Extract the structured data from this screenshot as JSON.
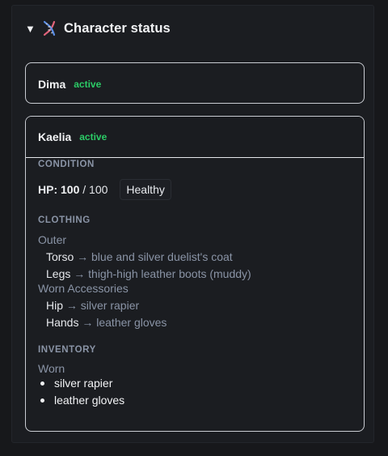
{
  "panel": {
    "caret": "▼",
    "icon": "dna-icon",
    "title": "Character status"
  },
  "characters": [
    {
      "name": "Dima",
      "status": "active"
    },
    {
      "name": "Kaelia",
      "status": "active"
    }
  ],
  "detail": {
    "condition": {
      "label": "CONDITION",
      "hp_prefix": "HP:",
      "hp_current": "100",
      "hp_separator": "/ 100",
      "health_badge": "Healthy"
    },
    "clothing": {
      "label": "CLOTHING",
      "outer_label": "Outer",
      "outer_items": [
        {
          "slot": "Torso",
          "value": "blue and silver duelist's coat"
        },
        {
          "slot": "Legs",
          "value": "thigh-high leather boots (muddy)"
        }
      ],
      "accessories_label": "Worn Accessories",
      "accessory_items": [
        {
          "slot": "Hip",
          "value": "silver rapier"
        },
        {
          "slot": "Hands",
          "value": "leather gloves"
        }
      ],
      "arrow": "→"
    },
    "inventory": {
      "label": "INVENTORY",
      "worn_label": "Worn",
      "worn_items": [
        "silver rapier",
        "leather gloves"
      ]
    }
  },
  "colors": {
    "accent_active": "#2bcb66",
    "muted": "#8a94a6",
    "background": "#17181b"
  }
}
